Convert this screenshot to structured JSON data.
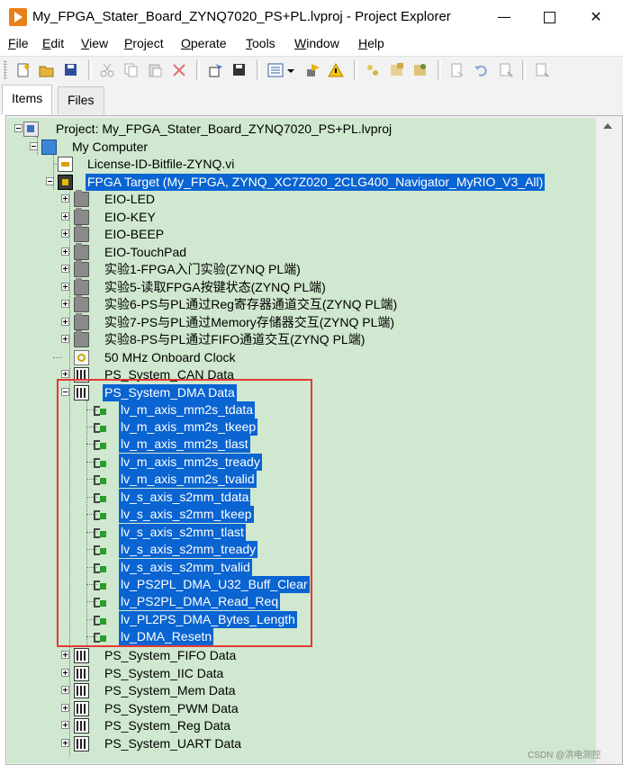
{
  "window": {
    "title": "My_FPGA_Stater_Board_ZYNQ7020_PS+PL.lvproj - Project Explorer",
    "controls": {
      "minimize": "—",
      "maximize": "",
      "close": "✕"
    }
  },
  "menu": [
    {
      "accel": "F",
      "rest": "ile"
    },
    {
      "accel": "E",
      "rest": "dit"
    },
    {
      "accel": "V",
      "rest": "iew"
    },
    {
      "accel": "P",
      "rest": "roject"
    },
    {
      "accel": "O",
      "rest": "perate"
    },
    {
      "accel": "T",
      "rest": "ools"
    },
    {
      "accel": "W",
      "rest": "indow"
    },
    {
      "accel": "H",
      "rest": "elp"
    }
  ],
  "toolbar": {
    "buttons": [
      "new-icon",
      "open-icon",
      "save-all-icon",
      "cut-icon",
      "copy-icon",
      "paste-icon",
      "delete-icon",
      "build-icon",
      "save-build-icon",
      "view-options-icon",
      "dropdown-arrow-icon",
      "deploy-icon",
      "warning-icon",
      "properties-icon",
      "vi-icon",
      "library-icon",
      "open-file-icon",
      "undo-icon",
      "redo-icon",
      "help-icon"
    ],
    "colors": {
      "accent": "#0a64d2"
    }
  },
  "tabs": [
    {
      "label": "Items",
      "active": true
    },
    {
      "label": "Files",
      "active": false
    }
  ],
  "tree": {
    "background": "#cfe8cf",
    "selection_color": "#0a64d2",
    "items": [
      {
        "label": "Project: My_FPGA_Stater_Board_ZYNQ7020_PS+PL.lvproj",
        "icon": "project-icon"
      },
      {
        "label": "My Computer",
        "icon": "computer-icon"
      },
      {
        "label": "License-ID-Bitfile-ZYNQ.vi",
        "icon": "vi-icon"
      },
      {
        "label": "FPGA Target (My_FPGA, ZYNQ_XC7Z020_2CLG400_Navigator_MyRIO_V3_All)",
        "icon": "fpga-target-icon"
      },
      {
        "label": "EIO-LED",
        "icon": "folder-icon"
      },
      {
        "label": "EIO-KEY",
        "icon": "folder-icon"
      },
      {
        "label": "EIO-BEEP",
        "icon": "folder-icon"
      },
      {
        "label": "EIO-TouchPad",
        "icon": "folder-icon"
      },
      {
        "label": "实验1-FPGA入门实验(ZYNQ PL端)",
        "icon": "folder-icon"
      },
      {
        "label": "实验5-读取FPGA按键状态(ZYNQ PL端)",
        "icon": "folder-icon"
      },
      {
        "label": "实验6-PS与PL通过Reg寄存器通道交互(ZYNQ PL端)",
        "icon": "folder-icon"
      },
      {
        "label": "实验7-PS与PL通过Memory存储器交互(ZYNQ PL端)",
        "icon": "folder-icon"
      },
      {
        "label": "实验8-PS与PL通过FIFO通道交互(ZYNQ PL端)",
        "icon": "folder-icon"
      },
      {
        "label": "50 MHz Onboard Clock",
        "icon": "clock-icon"
      },
      {
        "label": "PS_System_CAN Data",
        "icon": "chip-icon"
      },
      {
        "label": "PS_System_DMA Data",
        "icon": "chip-icon"
      },
      {
        "label": "lv_m_axis_mm2s_tdata",
        "icon": "io-node-icon"
      },
      {
        "label": "lv_m_axis_mm2s_tkeep",
        "icon": "io-node-icon"
      },
      {
        "label": "lv_m_axis_mm2s_tlast",
        "icon": "io-node-icon"
      },
      {
        "label": "lv_m_axis_mm2s_tready",
        "icon": "io-node-icon"
      },
      {
        "label": "lv_m_axis_mm2s_tvalid",
        "icon": "io-node-icon"
      },
      {
        "label": "lv_s_axis_s2mm_tdata",
        "icon": "io-node-icon"
      },
      {
        "label": "lv_s_axis_s2mm_tkeep",
        "icon": "io-node-icon"
      },
      {
        "label": "lv_s_axis_s2mm_tlast",
        "icon": "io-node-icon"
      },
      {
        "label": "lv_s_axis_s2mm_tready",
        "icon": "io-node-icon"
      },
      {
        "label": "lv_s_axis_s2mm_tvalid",
        "icon": "io-node-icon"
      },
      {
        "label": "lv_PS2PL_DMA_U32_Buff_Clear",
        "icon": "io-node-icon"
      },
      {
        "label": "lv_PS2PL_DMA_Read_Req",
        "icon": "io-node-icon"
      },
      {
        "label": "lv_PL2PS_DMA_Bytes_Length",
        "icon": "io-node-icon"
      },
      {
        "label": "lv_DMA_Resetn",
        "icon": "io-node-icon"
      },
      {
        "label": "PS_System_FIFO Data",
        "icon": "chip-icon"
      },
      {
        "label": "PS_System_IIC Data",
        "icon": "chip-icon"
      },
      {
        "label": "PS_System_Mem Data",
        "icon": "chip-icon"
      },
      {
        "label": "PS_System_PWM Data",
        "icon": "chip-icon"
      },
      {
        "label": "PS_System_Reg Data",
        "icon": "chip-icon"
      },
      {
        "label": "PS_System_UART Data",
        "icon": "chip-icon"
      }
    ]
  },
  "watermark": "CSDN @洪电测控"
}
